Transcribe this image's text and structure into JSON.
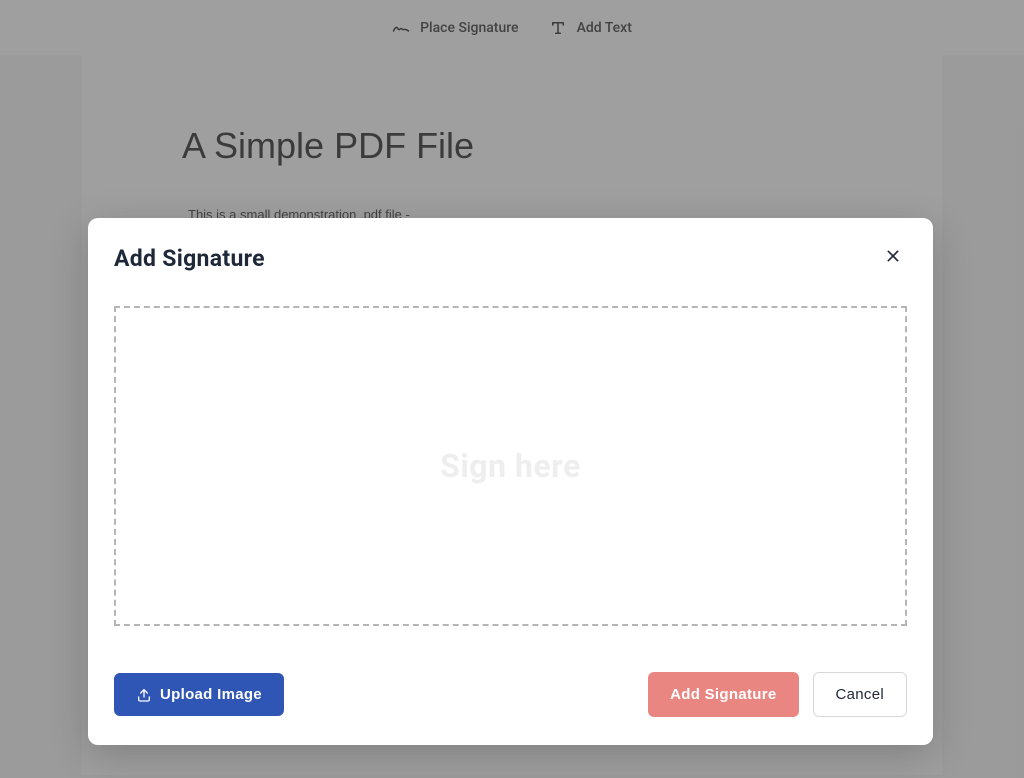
{
  "toolbar": {
    "place_signature": "Place Signature",
    "add_text": "Add Text"
  },
  "pdf": {
    "title": "A Simple PDF File",
    "line1": "This is a small demonstration .pdf file -"
  },
  "modal": {
    "title": "Add Signature",
    "sign_here": "Sign here",
    "upload_image": "Upload Image",
    "add_signature": "Add Signature",
    "cancel": "Cancel"
  }
}
